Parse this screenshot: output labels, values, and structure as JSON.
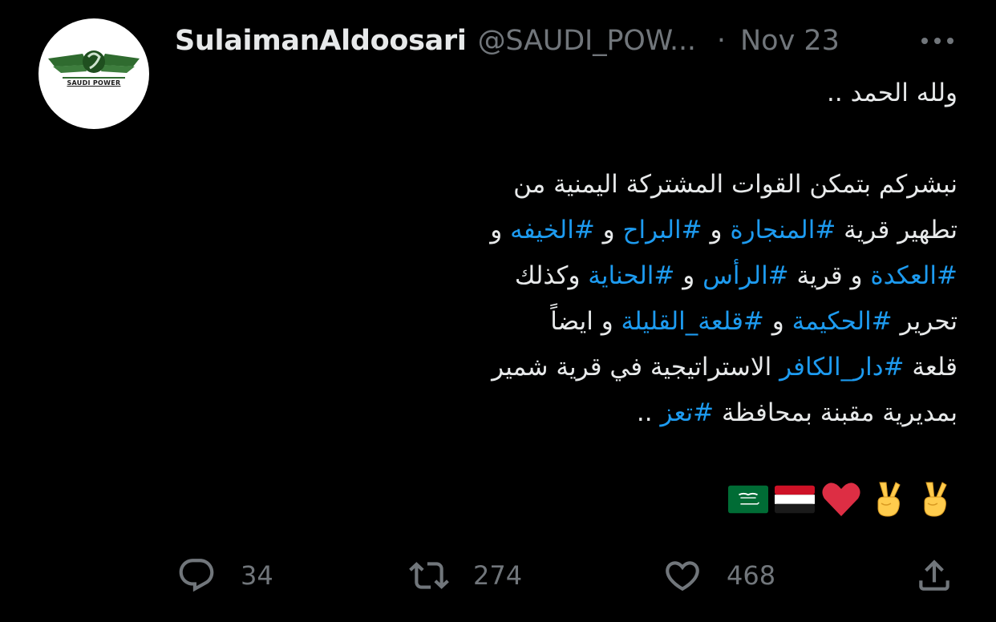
{
  "author": {
    "display_name": "SulaimanAldoosari",
    "handle": "@SAUDI_POW...",
    "separator": "·",
    "date": "Nov 23",
    "avatar_label": "SAUDI POWER"
  },
  "body": {
    "line1": "ولله الحمد ..",
    "line2": "نبشركم بتمكن القوات المشتركة اليمنية من",
    "line3_pre": "تطهير قرية ",
    "line3_tag1": "#المنجارة",
    "line3_mid1": " و ",
    "line3_tag2": "#البراح",
    "line3_mid2": " و ",
    "line3_tag3": "#الخيفه",
    "line3_post": " و",
    "line4_tag1": "#العكدة",
    "line4_mid1": " و قرية ",
    "line4_tag2": "#الرأس",
    "line4_mid2": " و ",
    "line4_tag3": "#الحناية",
    "line4_post": " وكذلك",
    "line5_pre": "تحرير ",
    "line5_tag1": "#الحكيمة",
    "line5_mid1": " و ",
    "line5_tag2": "#قلعة_القليلة",
    "line5_post": " و ايضاً",
    "line6_pre": "قلعة ",
    "line6_tag1": "#دار_الكافر",
    "line6_post": " الاستراتيجية في قرية شمير",
    "line7_pre": "بمديرية مقبنة بمحافظة ",
    "line7_tag1": "#تعز",
    "line7_post": " .."
  },
  "emojis": [
    "victory-hand",
    "victory-hand",
    "red-heart",
    "flag-yemen",
    "flag-saudi-arabia"
  ],
  "actions": {
    "reply_count": "34",
    "retweet_count": "274",
    "like_count": "468"
  },
  "colors": {
    "background": "#000000",
    "text": "#e7e9ea",
    "muted": "#71767b",
    "link": "#1d9bf0"
  }
}
